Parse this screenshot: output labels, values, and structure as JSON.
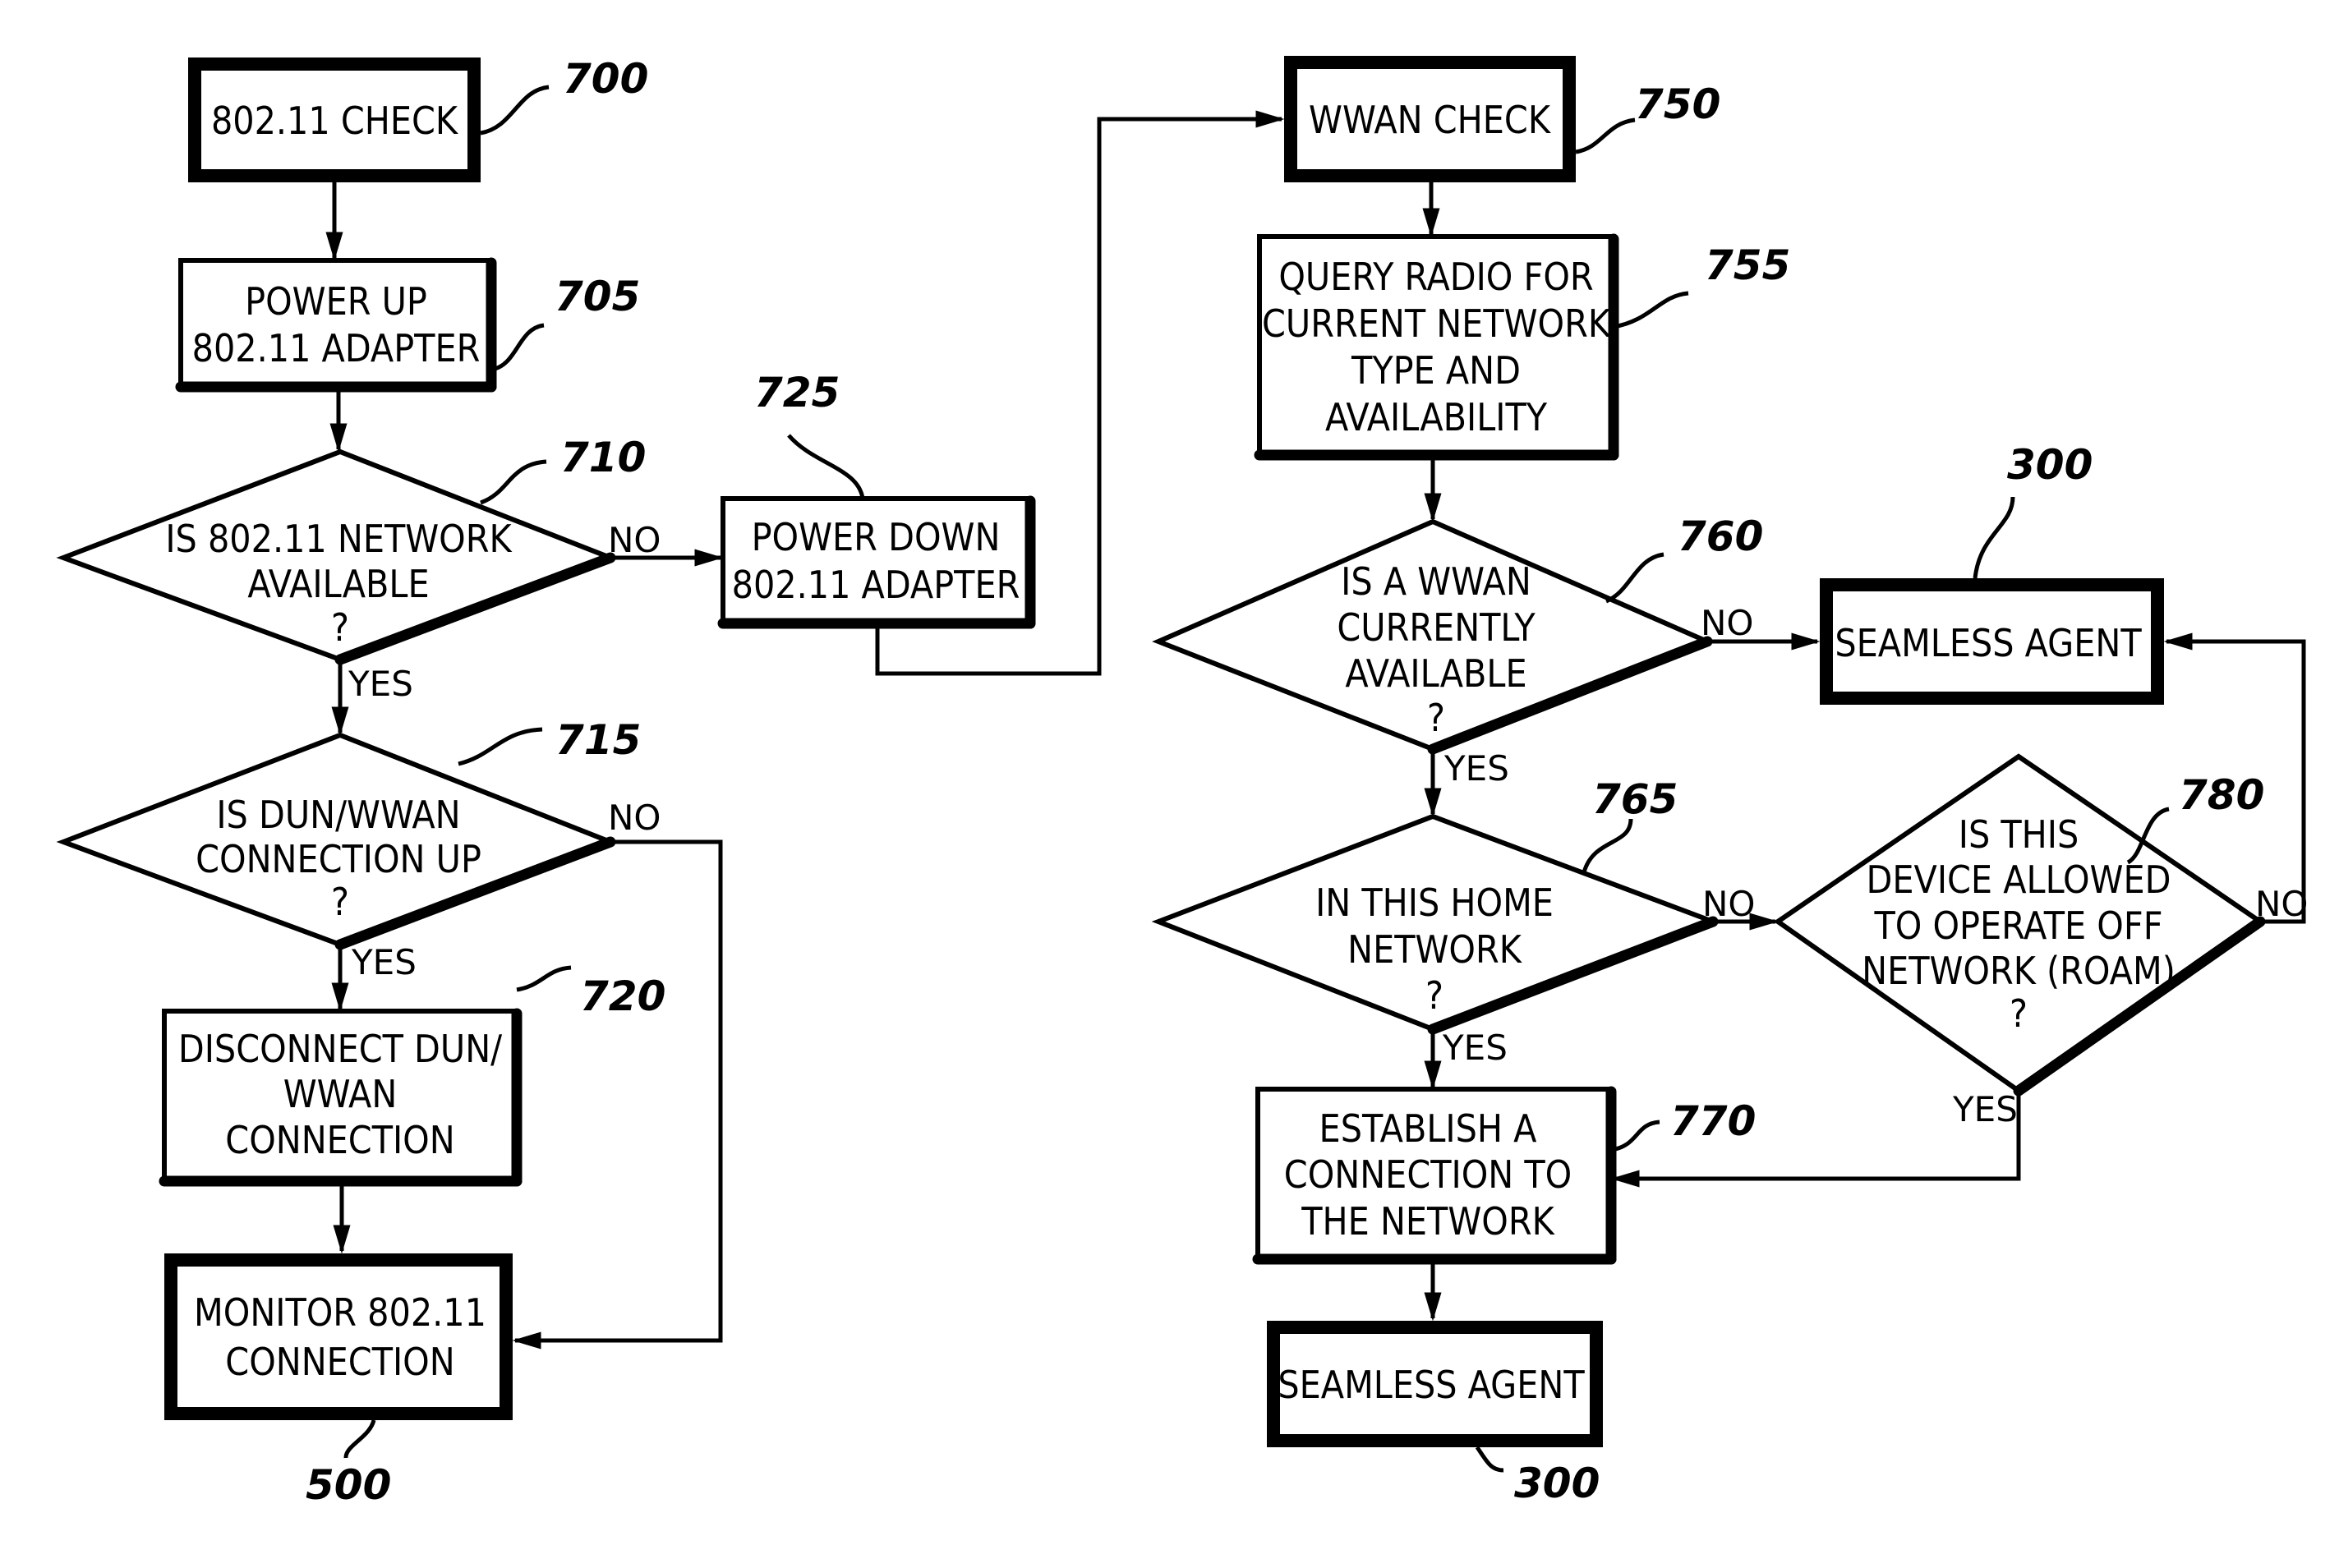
{
  "figure": {
    "nodes": {
      "n700": {
        "ref": "700",
        "lines": [
          "802.11 CHECK"
        ]
      },
      "n705": {
        "ref": "705",
        "lines": [
          "POWER UP",
          "802.11 ADAPTER"
        ]
      },
      "n710": {
        "ref": "710",
        "lines": [
          "IS 802.11 NETWORK",
          "AVAILABLE",
          "?"
        ]
      },
      "n715": {
        "ref": "715",
        "lines": [
          "IS DUN/WWAN",
          "CONNECTION UP",
          "?"
        ]
      },
      "n720": {
        "ref": "720",
        "lines": [
          "DISCONNECT DUN/",
          "WWAN",
          "CONNECTION"
        ]
      },
      "n500": {
        "ref": "500",
        "lines": [
          "MONITOR 802.11",
          "CONNECTION"
        ]
      },
      "n725": {
        "ref": "725",
        "lines": [
          "POWER DOWN",
          "802.11 ADAPTER"
        ]
      },
      "n750": {
        "ref": "750",
        "lines": [
          "WWAN CHECK"
        ]
      },
      "n755": {
        "ref": "755",
        "lines": [
          "QUERY RADIO FOR",
          "CURRENT NETWORK",
          "TYPE AND",
          "AVAILABILITY"
        ]
      },
      "n760": {
        "ref": "760",
        "lines": [
          "IS A WWAN",
          "CURRENTLY",
          "AVAILABLE",
          "?"
        ]
      },
      "n300a": {
        "ref": "300",
        "lines": [
          "SEAMLESS AGENT"
        ]
      },
      "n765": {
        "ref": "765",
        "lines": [
          "IN THIS HOME",
          "NETWORK",
          "?"
        ]
      },
      "n780": {
        "ref": "780",
        "lines": [
          "IS THIS",
          "DEVICE ALLOWED",
          "TO OPERATE OFF",
          "NETWORK (ROAM)",
          "?"
        ]
      },
      "n770": {
        "ref": "770",
        "lines": [
          "ESTABLISH A",
          "CONNECTION TO",
          "THE NETWORK"
        ]
      },
      "n300b": {
        "ref": "300",
        "lines": [
          "SEAMLESS AGENT"
        ]
      }
    },
    "edge_labels": {
      "yes": "YES",
      "no": "NO"
    }
  }
}
